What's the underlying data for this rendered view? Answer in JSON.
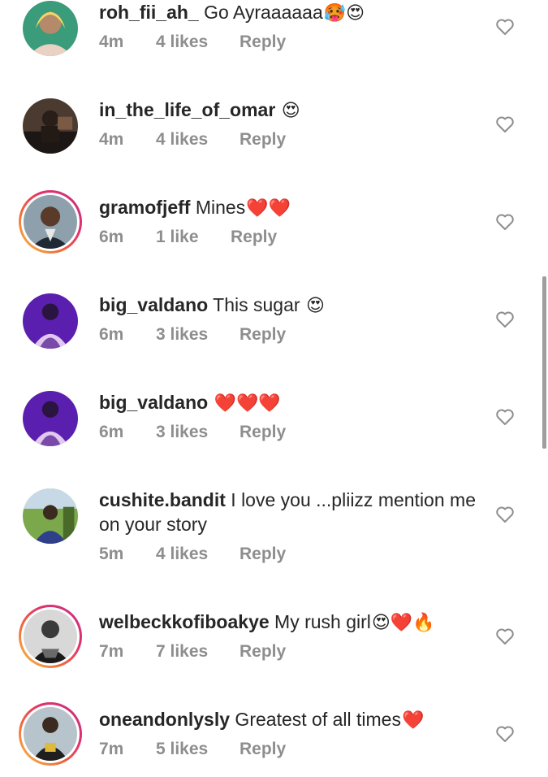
{
  "comments": [
    {
      "username": "roh_fii_ah_",
      "text": " Go Ayraaaaaa",
      "emojis": "🥵😍",
      "time": "4m",
      "likes": "4 likes",
      "reply": "Reply",
      "story_ring": false,
      "avatar_color": "#3a7c5f"
    },
    {
      "username": "in_the_life_of_omar",
      "text": " ",
      "emojis": "😍",
      "time": "4m",
      "likes": "4 likes",
      "reply": "Reply",
      "story_ring": false,
      "avatar_color": "#3b2f2a"
    },
    {
      "username": "gramofjeff",
      "text": " Mines",
      "emojis": "❤️❤️",
      "time": "6m",
      "likes": "1 like",
      "reply": "Reply",
      "story_ring": true,
      "avatar_color": "#6e7f8f"
    },
    {
      "username": "big_valdano",
      "text": " This sugar ",
      "emojis": "😍",
      "time": "6m",
      "likes": "3 likes",
      "reply": "Reply",
      "story_ring": false,
      "avatar_color": "#5a1fa8"
    },
    {
      "username": "big_valdano",
      "text": " ",
      "emojis": "❤️❤️❤️",
      "time": "6m",
      "likes": "3 likes",
      "reply": "Reply",
      "story_ring": false,
      "avatar_color": "#5a1fa8"
    },
    {
      "username": "cushite.bandit",
      "text": " I love you ...pliizz mention me on your story",
      "emojis": "",
      "time": "5m",
      "likes": "4 likes",
      "reply": "Reply",
      "story_ring": false,
      "avatar_color": "#6b8f3d"
    },
    {
      "username": "welbeckkofiboakye",
      "text": " My rush girl",
      "emojis": "😍❤️🔥",
      "time": "7m",
      "likes": "7 likes",
      "reply": "Reply",
      "story_ring": true,
      "avatar_color": "#2b2b2b"
    },
    {
      "username": "oneandonlysly",
      "text": " Greatest of all times",
      "emojis": "❤️",
      "time": "7m",
      "likes": "5 likes",
      "reply": "Reply",
      "story_ring": true,
      "avatar_color": "#c9a33a"
    }
  ],
  "colors": {
    "text": "#262626",
    "meta": "#8e8e8e",
    "heart_outline": "#8e8e8e"
  }
}
